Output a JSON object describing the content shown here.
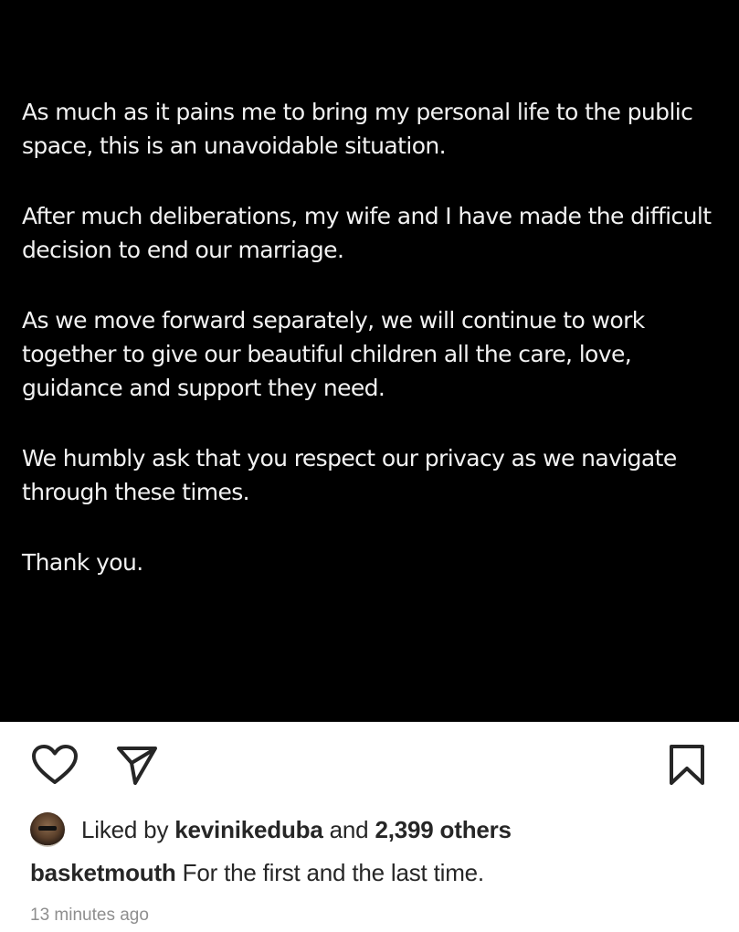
{
  "post": {
    "paragraphs": [
      "As much as it pains me to bring my personal life to the public space, this is an unavoidable situation.",
      "After much deliberations, my wife and I have made the difficult  decision to end our marriage.",
      "As we move forward separately, we will continue to work together to give our beautiful children all the care, love, guidance and support they need.",
      "We humbly ask that you respect our privacy as we navigate through these times.",
      "Thank you."
    ]
  },
  "actions": {
    "like_icon": "heart-icon",
    "share_icon": "paper-plane-icon",
    "save_icon": "bookmark-icon"
  },
  "likes": {
    "prefix": "Liked by",
    "user": "kevinikeduba",
    "conjunction": "and",
    "others": "2,399 others"
  },
  "caption": {
    "username": "basketmouth",
    "text": "For the first and the last time."
  },
  "timestamp": "13 minutes ago",
  "colors": {
    "image_background": "#000000",
    "image_text": "#f2f2f2",
    "primary_text": "#262626",
    "secondary_text": "#8e8e8e"
  }
}
